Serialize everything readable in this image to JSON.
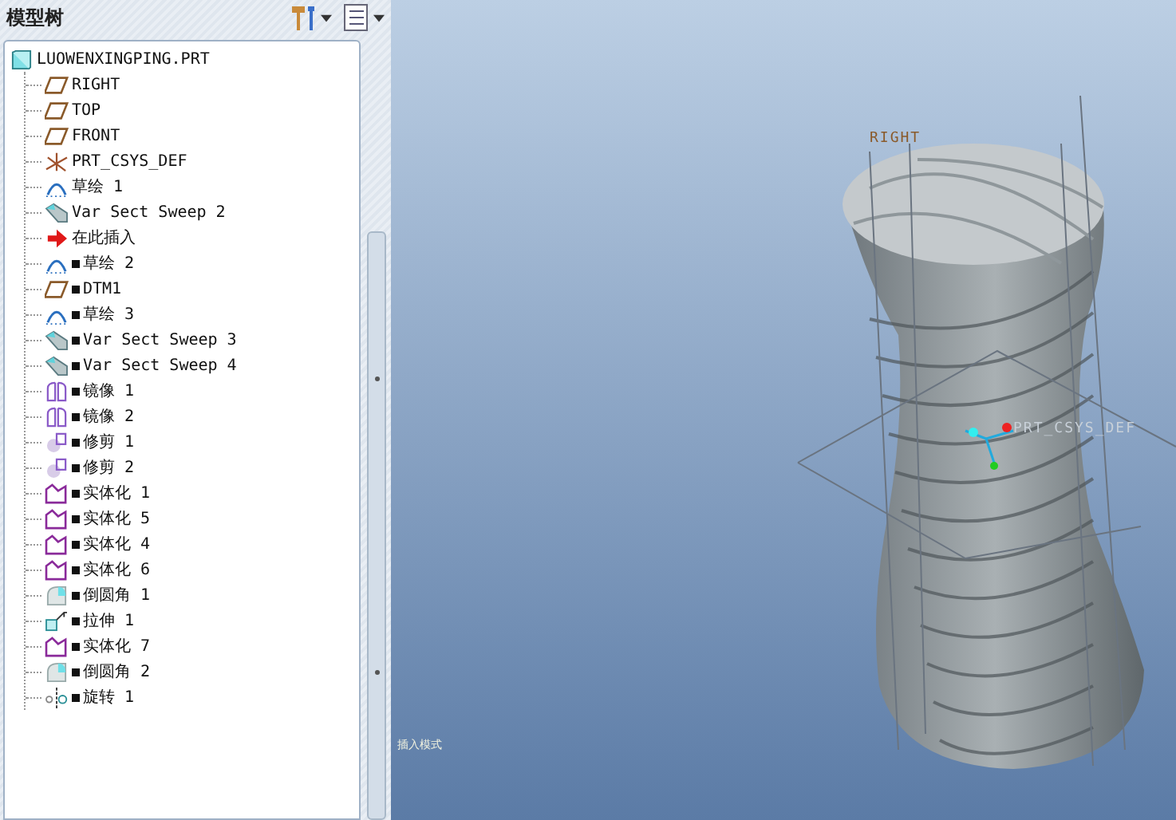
{
  "panel": {
    "title": "模型树"
  },
  "tree": {
    "label": "LUOWENXINGPING.PRT",
    "kind": "part",
    "children": [
      {
        "label": "RIGHT",
        "kind": "plane",
        "marked": false
      },
      {
        "label": "TOP",
        "kind": "plane",
        "marked": false
      },
      {
        "label": "FRONT",
        "kind": "plane",
        "marked": false
      },
      {
        "label": "PRT_CSYS_DEF",
        "kind": "csys",
        "marked": false
      },
      {
        "label": "草绘 1",
        "kind": "sketch",
        "marked": false
      },
      {
        "label": "Var Sect Sweep 2",
        "kind": "sweep",
        "marked": false
      },
      {
        "label": "在此插入",
        "kind": "insert",
        "marked": false
      },
      {
        "label": "草绘 2",
        "kind": "sketch",
        "marked": true
      },
      {
        "label": "DTM1",
        "kind": "plane",
        "marked": true
      },
      {
        "label": "草绘 3",
        "kind": "sketch",
        "marked": true
      },
      {
        "label": "Var Sect Sweep 3",
        "kind": "sweep",
        "marked": true
      },
      {
        "label": "Var Sect Sweep 4",
        "kind": "sweep",
        "marked": true
      },
      {
        "label": "镜像 1",
        "kind": "mirror",
        "marked": true
      },
      {
        "label": "镜像 2",
        "kind": "mirror",
        "marked": true
      },
      {
        "label": "修剪 1",
        "kind": "trim",
        "marked": true
      },
      {
        "label": "修剪 2",
        "kind": "trim",
        "marked": true
      },
      {
        "label": "实体化 1",
        "kind": "solidify",
        "marked": true
      },
      {
        "label": "实体化 5",
        "kind": "solidify",
        "marked": true
      },
      {
        "label": "实体化 4",
        "kind": "solidify",
        "marked": true
      },
      {
        "label": "实体化 6",
        "kind": "solidify",
        "marked": true
      },
      {
        "label": "倒圆角 1",
        "kind": "round",
        "marked": true
      },
      {
        "label": "拉伸 1",
        "kind": "extrude",
        "marked": true
      },
      {
        "label": "实体化 7",
        "kind": "solidify",
        "marked": true
      },
      {
        "label": "倒圆角 2",
        "kind": "round",
        "marked": true
      },
      {
        "label": "旋转 1",
        "kind": "revolve",
        "marked": true
      }
    ]
  },
  "viewport": {
    "datum_labels": [
      "RIGHT",
      "PRT_CSYS_DEF"
    ],
    "status_text": "插入模式"
  }
}
